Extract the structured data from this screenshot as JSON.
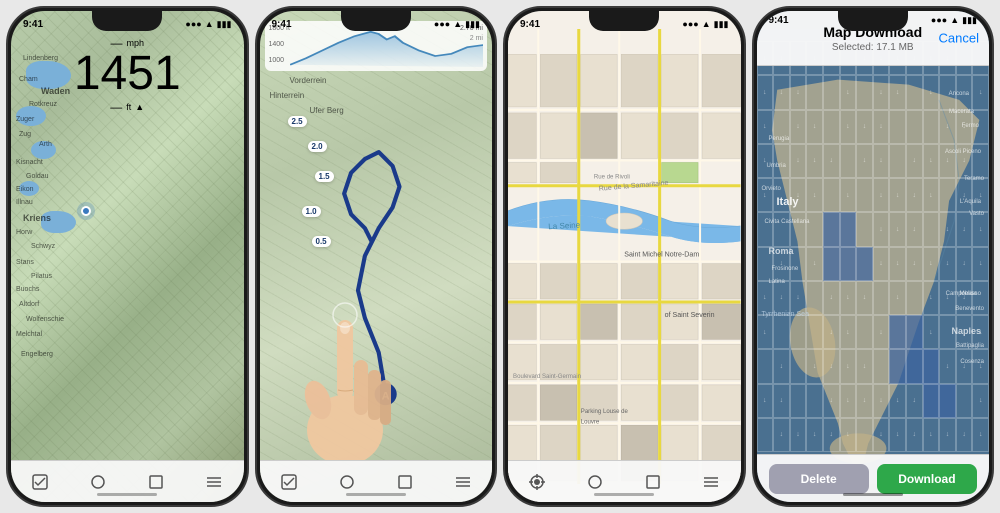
{
  "phones": [
    {
      "id": "phone1",
      "type": "topo",
      "status": {
        "time": "9:41",
        "signal": "●●●",
        "wifi": "wifi",
        "battery": "■■■"
      },
      "overlay": {
        "speed_unit": "mph",
        "speed_value": "1451",
        "alt_label": "ft",
        "arrow": "▲"
      },
      "toolbar_icons": [
        "checkbox-icon",
        "circle-icon",
        "square-icon",
        "lines-icon"
      ]
    },
    {
      "id": "phone2",
      "type": "route",
      "status": {
        "time": "9:41",
        "signal": "●●●",
        "wifi": "wifi",
        "battery": "■■■"
      },
      "elevation": {
        "max": "1800 ft",
        "mid": "1400",
        "min": "1000",
        "distance_max": "2.70 mi"
      },
      "distances": [
        "2.5",
        "2.0",
        "1.5",
        "1.0",
        "0.5"
      ],
      "toolbar_icons": [
        "checkbox-icon",
        "circle-icon",
        "square-icon",
        "lines-icon"
      ]
    },
    {
      "id": "phone3",
      "type": "city",
      "status": {
        "time": "9:41",
        "signal": "●●●",
        "wifi": "wifi",
        "battery": "■■■"
      },
      "toolbar_icons": [
        "location-icon",
        "circle-icon",
        "square-icon",
        "lines-icon"
      ]
    },
    {
      "id": "phone4",
      "type": "download",
      "status": {
        "time": "9:41",
        "signal": "●●●",
        "wifi": "wifi",
        "battery": "■■■"
      },
      "header": {
        "title": "Map Download",
        "subtitle": "Selected: 17.1 MB",
        "cancel_label": "Cancel"
      },
      "places": [
        "Ancona",
        "Macerata",
        "Fermo",
        "Perugia",
        "Ascoli Piceno",
        "Umbria",
        "Teramo",
        "Orvieto",
        "L'Aquila",
        "Vasto",
        "Civita Castellana",
        "Frosinone",
        "Latina",
        "Roma",
        "Campobasso",
        "Tyrrhanian Sea",
        "Naples",
        "Battipaglia",
        "Cosenza"
      ],
      "italy_label": "Italy",
      "buttons": {
        "delete_label": "Delete",
        "download_label": "Download"
      }
    }
  ]
}
